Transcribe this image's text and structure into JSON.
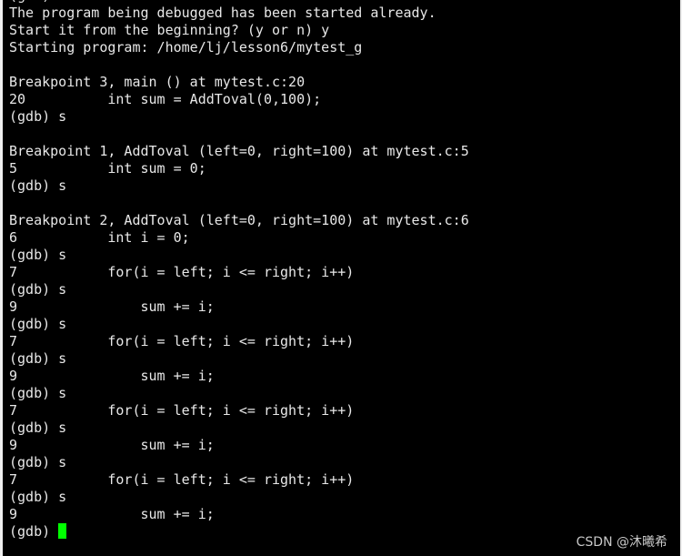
{
  "terminal": {
    "lines": [
      "(gdb) r",
      "The program being debugged has been started already.",
      "Start it from the beginning? (y or n) y",
      "Starting program: /home/lj/lesson6/mytest_g",
      "",
      "Breakpoint 3, main () at mytest.c:20",
      "20          int sum = AddToval(0,100);",
      "(gdb) s",
      "",
      "Breakpoint 1, AddToval (left=0, right=100) at mytest.c:5",
      "5           int sum = 0;",
      "(gdb) s",
      "",
      "Breakpoint 2, AddToval (left=0, right=100) at mytest.c:6",
      "6           int i = 0;",
      "(gdb) s",
      "7           for(i = left; i <= right; i++)",
      "(gdb) s",
      "9               sum += i;",
      "(gdb) s",
      "7           for(i = left; i <= right; i++)",
      "(gdb) s",
      "9               sum += i;",
      "(gdb) s",
      "7           for(i = left; i <= right; i++)",
      "(gdb) s",
      "9               sum += i;",
      "(gdb) s",
      "7           for(i = left; i <= right; i++)",
      "(gdb) s",
      "9               sum += i;"
    ],
    "prompt": "(gdb) ",
    "cursor_color": "#00ff00"
  },
  "watermark": "CSDN @沐曦希"
}
